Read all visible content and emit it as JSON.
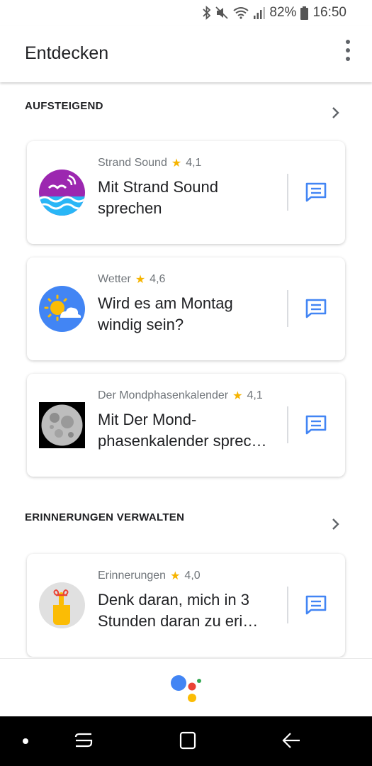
{
  "status_bar": {
    "battery": "82%",
    "time": "16:50",
    "icons": [
      "bluetooth-icon",
      "mute-icon",
      "wifi-icon",
      "signal-icon",
      "battery-icon"
    ]
  },
  "app_bar": {
    "title": "Entdecken",
    "menu_icon": "overflow-menu-icon"
  },
  "sections": [
    {
      "title": "AUFSTEIGEND",
      "cards": [
        {
          "name": "Strand Sound",
          "rating": "4,1",
          "title": "Mit Strand Sound sprechen",
          "icon": "strand-sound-icon"
        },
        {
          "name": "Wetter",
          "rating": "4,6",
          "title": "Wird es am Montag windig sein?",
          "icon": "weather-icon"
        },
        {
          "name": "Der Mondphasenkalender",
          "rating": "4,1",
          "title": "Mit Der Mond- phasenkalender sprec…",
          "icon": "moon-icon"
        }
      ]
    },
    {
      "title": "ERINNERUNGEN VERWALTEN",
      "cards": [
        {
          "name": "Erinnerungen",
          "rating": "4,0",
          "title": "Denk daran, mich in 3 Stunden daran zu eri…",
          "icon": "reminder-icon"
        }
      ]
    }
  ],
  "star_glyph": "★",
  "colors": {
    "accent_blue": "#4285f4",
    "star": "#f6b400",
    "google_red": "#ea4335",
    "google_yellow": "#fbbc05",
    "google_green": "#34a853"
  },
  "bottom": {
    "logo": "google-assistant-logo"
  },
  "nav_bar": [
    "nav-dot",
    "recent-apps-icon",
    "home-icon",
    "back-icon"
  ]
}
